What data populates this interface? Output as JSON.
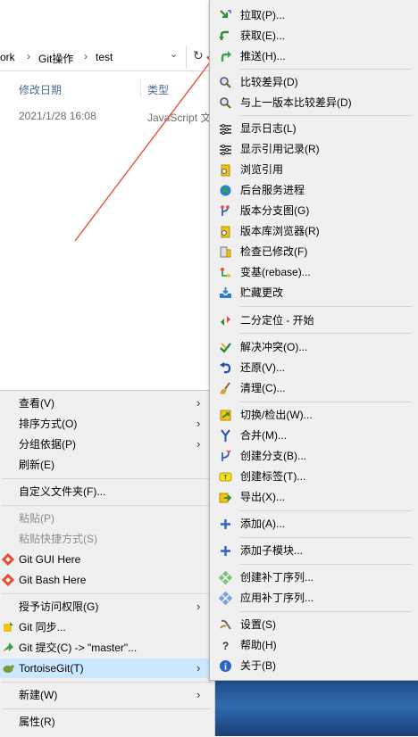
{
  "explorer": {
    "breadcrumbs": [
      "ork",
      "Git操作",
      "test"
    ],
    "columns": [
      "修改日期",
      "类型"
    ],
    "row": {
      "date": "2021/1/28 16:08",
      "type": "JavaScript 文"
    }
  },
  "context_menu": {
    "items": [
      {
        "label": "查看(V)",
        "submenu": true
      },
      {
        "label": "排序方式(O)",
        "submenu": true
      },
      {
        "label": "分组依据(P)",
        "submenu": true
      },
      {
        "label": "刷新(E)"
      },
      {
        "label": "自定义文件夹(F)..."
      },
      {
        "label": "粘贴(P)",
        "disabled": true
      },
      {
        "label": "粘贴快捷方式(S)",
        "disabled": true
      },
      {
        "label": "Git GUI Here",
        "icon": "git-gui-icon"
      },
      {
        "label": "Git Bash Here",
        "icon": "git-bash-icon"
      },
      {
        "label": "授予访问权限(G)",
        "submenu": true
      },
      {
        "label": "Git 同步...",
        "icon": "git-sync-icon"
      },
      {
        "label": "Git 提交(C) -> \"master\"...",
        "icon": "git-commit-icon"
      },
      {
        "label": "TortoiseGit(T)",
        "submenu": true,
        "icon": "tortoisegit-icon",
        "highlighted": true
      },
      {
        "label": "新建(W)",
        "submenu": true
      },
      {
        "label": "属性(R)"
      }
    ]
  },
  "tortoise_menu": {
    "items": [
      {
        "label": "拉取(P)...",
        "icon": "pull-icon"
      },
      {
        "label": "获取(E)...",
        "icon": "fetch-icon"
      },
      {
        "label": "推送(H)...",
        "icon": "push-icon"
      },
      {
        "label": "比较差异(D)",
        "icon": "diff-icon"
      },
      {
        "label": "与上一版本比较差异(D)",
        "icon": "diff-previous-icon"
      },
      {
        "label": "显示日志(L)",
        "icon": "log-icon"
      },
      {
        "label": "显示引用记录(R)",
        "icon": "reflog-icon"
      },
      {
        "label": "浏览引用",
        "icon": "browse-refs-icon"
      },
      {
        "label": "后台服务进程",
        "icon": "daemon-icon"
      },
      {
        "label": "版本分支图(G)",
        "icon": "revision-graph-icon"
      },
      {
        "label": "版本库浏览器(R)",
        "icon": "repo-browser-icon"
      },
      {
        "label": "检查已修改(F)",
        "icon": "check-modifications-icon"
      },
      {
        "label": "变基(rebase)...",
        "icon": "rebase-icon"
      },
      {
        "label": "贮藏更改",
        "icon": "stash-icon"
      },
      {
        "label": "二分定位 - 开始",
        "icon": "bisect-icon"
      },
      {
        "label": "解决冲突(O)...",
        "icon": "resolve-icon"
      },
      {
        "label": "还原(V)...",
        "icon": "revert-icon"
      },
      {
        "label": "清理(C)...",
        "icon": "cleanup-icon"
      },
      {
        "label": "切换/检出(W)...",
        "icon": "switch-checkout-icon"
      },
      {
        "label": "合并(M)...",
        "icon": "merge-icon"
      },
      {
        "label": "创建分支(B)...",
        "icon": "branch-icon"
      },
      {
        "label": "创建标签(T)...",
        "icon": "tag-icon"
      },
      {
        "label": "导出(X)...",
        "icon": "export-icon"
      },
      {
        "label": "添加(A)...",
        "icon": "add-icon"
      },
      {
        "label": "添加子模块...",
        "icon": "add-submodule-icon"
      },
      {
        "label": "创建补丁序列...",
        "icon": "create-patch-icon"
      },
      {
        "label": "应用补丁序列...",
        "icon": "apply-patch-icon"
      },
      {
        "label": "设置(S)",
        "icon": "settings-icon"
      },
      {
        "label": "帮助(H)",
        "icon": "help-icon"
      },
      {
        "label": "关于(B)",
        "icon": "about-icon"
      }
    ]
  },
  "colors": {
    "menu_bg": "#f0f0f0",
    "highlight": "#cce8ff",
    "annotation_arrow": "#e8462a"
  }
}
